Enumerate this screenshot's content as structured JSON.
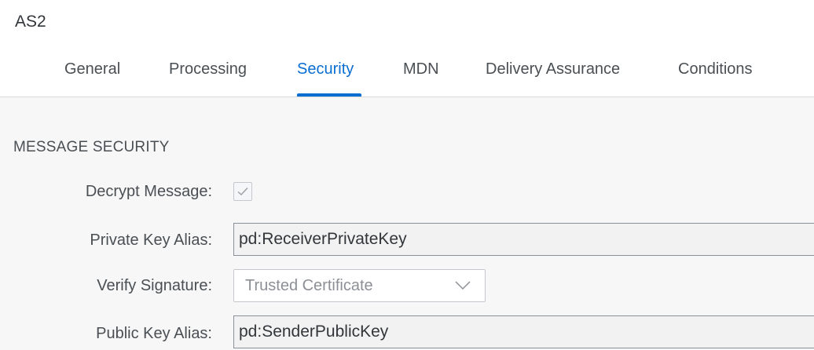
{
  "app": {
    "title": "AS2"
  },
  "tabs": [
    {
      "label": "General"
    },
    {
      "label": "Processing"
    },
    {
      "label": "Security",
      "selected": true
    },
    {
      "label": "MDN"
    },
    {
      "label": "Delivery Assurance"
    },
    {
      "label": "Conditions"
    }
  ],
  "message_security": {
    "section_title": "MESSAGE SECURITY",
    "decrypt_message": {
      "label": "Decrypt Message:",
      "checked": true
    },
    "private_key_alias": {
      "label": "Private Key Alias:",
      "value": "pd:ReceiverPrivateKey"
    },
    "verify_signature": {
      "label": "Verify Signature:",
      "selected": "Trusted Certificate"
    },
    "public_key_alias": {
      "label": "Public Key Alias:",
      "value": "pd:SenderPublicKey"
    }
  },
  "colors": {
    "accent": "#0a6ed1",
    "text": "#32363a",
    "background": "#f7f7f7"
  },
  "icons": {
    "checkbox_check": "check-icon",
    "dropdown": "chevron-down-icon"
  }
}
